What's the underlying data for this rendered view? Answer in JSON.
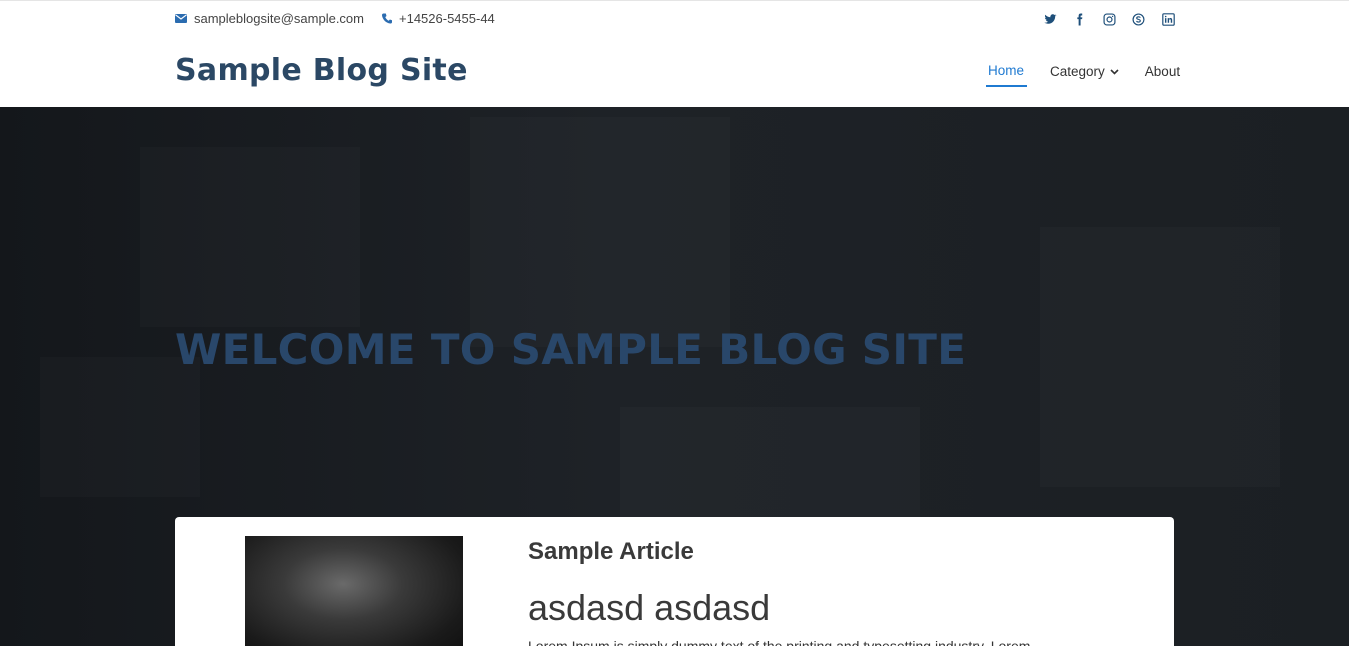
{
  "topbar": {
    "email": "sampleblogsite@sample.com",
    "phone": "+14526-5455-44",
    "social": [
      "twitter-icon",
      "facebook-icon",
      "instagram-icon",
      "skype-icon",
      "linkedin-icon"
    ]
  },
  "header": {
    "logo": "Sample Blog Site",
    "nav": [
      {
        "label": "Home",
        "active": true
      },
      {
        "label": "Category",
        "has_dropdown": true
      },
      {
        "label": "About"
      }
    ]
  },
  "hero": {
    "heading": "WELCOME TO SAMPLE BLOG SITE"
  },
  "article": {
    "category": "Sample Article",
    "title": "asdasd asdasd",
    "excerpt": "Lorem Ipsum is simply dummy text of the printing and typesetting industry. Lorem"
  },
  "colors": {
    "brand": "#2b4865",
    "accent": "#1f7ad1",
    "hero_bg": "#1b1f23"
  }
}
